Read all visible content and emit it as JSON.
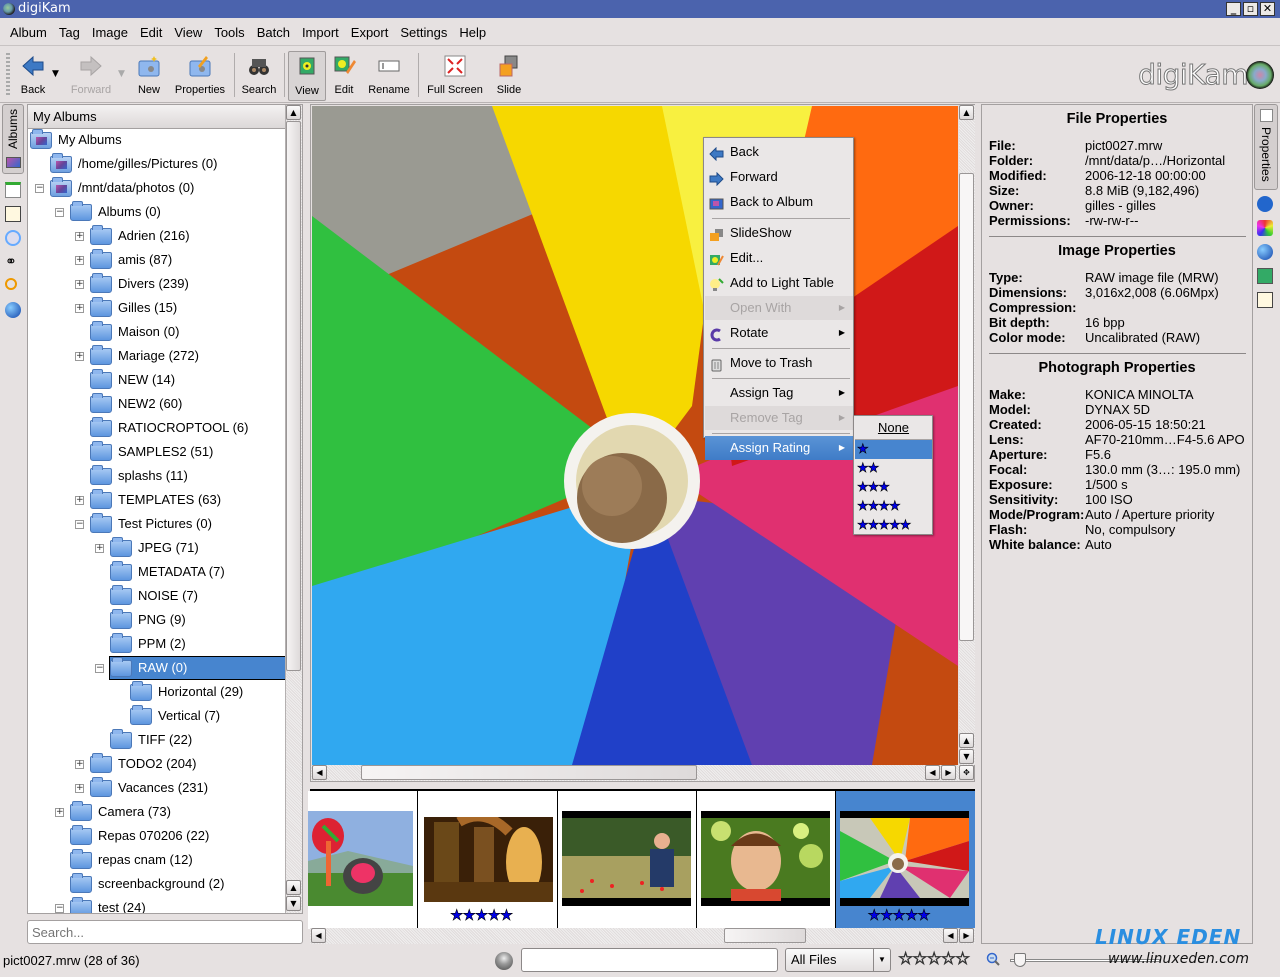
{
  "window": {
    "title": "digiKam",
    "logo_text": "digiKam"
  },
  "menubar": [
    {
      "label": "Album",
      "u": "A",
      "rest": "lbum"
    },
    {
      "label": "Tag",
      "u": "",
      "rest": "Tag"
    },
    {
      "label": "Image",
      "u": "I",
      "rest": "mage"
    },
    {
      "label": "Edit",
      "u": "E",
      "rest": "dit"
    },
    {
      "label": "View",
      "u": "V",
      "rest": "iew"
    },
    {
      "label": "Tools",
      "u": "T",
      "rest": "ools"
    },
    {
      "label": "Batch",
      "u": "B",
      "rest": "atch"
    },
    {
      "label": "Import",
      "u": "",
      "rest": "Import"
    },
    {
      "label": "Export",
      "u": "",
      "rest": "Export"
    },
    {
      "label": "Settings",
      "u": "S",
      "rest": "ettings"
    },
    {
      "label": "Help",
      "u": "H",
      "rest": "elp"
    }
  ],
  "toolbar": {
    "back": "Back",
    "forward": "Forward",
    "new": "New",
    "properties": "Properties",
    "search": "Search",
    "view": "View",
    "edit": "Edit",
    "rename": "Rename",
    "fullscreen": "Full Screen",
    "slide": "Slide"
  },
  "left_tabs": {
    "albums": "Albums"
  },
  "tree": {
    "header": "My Albums",
    "nodes": [
      {
        "label": "My Albums",
        "level": 0,
        "icon": "album"
      },
      {
        "label": "/home/gilles/Pictures (0)",
        "level": 1,
        "icon": "album"
      },
      {
        "label": "/mnt/data/photos (0)",
        "level": 1,
        "icon": "album",
        "exp": "-"
      },
      {
        "label": "Albums (0)",
        "level": 2,
        "exp": "-"
      },
      {
        "label": "Adrien (216)",
        "level": 3,
        "exp": "+"
      },
      {
        "label": "amis (87)",
        "level": 3,
        "exp": "+"
      },
      {
        "label": "Divers (239)",
        "level": 3,
        "exp": "+"
      },
      {
        "label": "Gilles (15)",
        "level": 3,
        "exp": "+"
      },
      {
        "label": "Maison (0)",
        "level": 3
      },
      {
        "label": "Mariage (272)",
        "level": 3,
        "exp": "+"
      },
      {
        "label": "NEW (14)",
        "level": 3
      },
      {
        "label": "NEW2 (60)",
        "level": 3
      },
      {
        "label": "RATIOCROPTOOL (6)",
        "level": 3
      },
      {
        "label": "SAMPLES2 (51)",
        "level": 3
      },
      {
        "label": "splashs (11)",
        "level": 3
      },
      {
        "label": "TEMPLATES (63)",
        "level": 3,
        "exp": "+"
      },
      {
        "label": "Test Pictures (0)",
        "level": 3,
        "exp": "-"
      },
      {
        "label": "JPEG (71)",
        "level": 4,
        "exp": "+"
      },
      {
        "label": "METADATA (7)",
        "level": 4
      },
      {
        "label": "NOISE (7)",
        "level": 4
      },
      {
        "label": "PNG (9)",
        "level": 4
      },
      {
        "label": "PPM (2)",
        "level": 4
      },
      {
        "label": "RAW (0)",
        "level": 4,
        "exp": "-",
        "selected": true
      },
      {
        "label": "Horizontal (29)",
        "level": 5
      },
      {
        "label": "Vertical (7)",
        "level": 5
      },
      {
        "label": "TIFF (22)",
        "level": 4
      },
      {
        "label": "TODO2 (204)",
        "level": 3,
        "exp": "+"
      },
      {
        "label": "Vacances (231)",
        "level": 3,
        "exp": "+"
      },
      {
        "label": "Camera (73)",
        "level": 2,
        "exp": "+"
      },
      {
        "label": "Repas 070206 (22)",
        "level": 2
      },
      {
        "label": "repas cnam (12)",
        "level": 2
      },
      {
        "label": "screenbackground (2)",
        "level": 2
      },
      {
        "label": "test (24)",
        "level": 2,
        "exp": "-"
      }
    ],
    "search_placeholder": "Search..."
  },
  "context_menu": {
    "items": [
      {
        "label": "Back",
        "icon": "back-arrow"
      },
      {
        "label": "Forward",
        "icon": "forward-arrow"
      },
      {
        "label": "Back to Album",
        "icon": "album"
      },
      {
        "sep": true
      },
      {
        "label": "SlideShow",
        "icon": "slideshow"
      },
      {
        "label": "Edit...",
        "icon": "edit"
      },
      {
        "label": "Add to Light Table",
        "icon": "lighttable"
      },
      {
        "label": "Open With",
        "disabled": true,
        "submenu": true
      },
      {
        "label": "Rotate",
        "icon": "rotate",
        "submenu": true
      },
      {
        "sep": true
      },
      {
        "label": "Move to Trash",
        "icon": "trash"
      },
      {
        "sep": true
      },
      {
        "label": "Assign Tag",
        "submenu": true
      },
      {
        "label": "Remove Tag",
        "disabled": true,
        "submenu": true
      },
      {
        "sep": true
      },
      {
        "label": "Assign Rating",
        "submenu": true,
        "highlighted": true
      }
    ]
  },
  "rating_submenu": {
    "none": "None",
    "options": [
      "★",
      "★★",
      "★★★",
      "★★★★",
      "★★★★★"
    ],
    "highlighted_index": 0
  },
  "properties": {
    "tab_label": "Properties",
    "file": {
      "title": "File Properties",
      "rows": [
        {
          "k": "File:",
          "v": "pict0027.mrw"
        },
        {
          "k": "Folder:",
          "v": "/mnt/data/p…/Horizontal"
        },
        {
          "k": "Modified:",
          "v": "2006-12-18 00:00:00"
        },
        {
          "k": "Size:",
          "v": "8.8 MiB (9,182,496)"
        },
        {
          "k": "Owner:",
          "v": "gilles - gilles"
        },
        {
          "k": "Permissions:",
          "v": "-rw-rw-r--"
        }
      ]
    },
    "image": {
      "title": "Image Properties",
      "rows": [
        {
          "k": "Type:",
          "v": "RAW image file (MRW)"
        },
        {
          "k": "Dimensions:",
          "v": "3,016x2,008 (6.06Mpx)"
        },
        {
          "k": "Compression:",
          "v": ""
        },
        {
          "k": "Bit depth:",
          "v": "16 bpp"
        },
        {
          "k": "Color mode:",
          "v": "Uncalibrated (RAW)"
        }
      ]
    },
    "photo": {
      "title": "Photograph Properties",
      "rows": [
        {
          "k": "Make:",
          "v": "KONICA MINOLTA"
        },
        {
          "k": "Model:",
          "v": "DYNAX 5D"
        },
        {
          "k": "Created:",
          "v": "2006-05-15 18:50:21"
        },
        {
          "k": "Lens:",
          "v": "AF70-210mm…F4-5.6 APO"
        },
        {
          "k": "Aperture:",
          "v": "F5.6"
        },
        {
          "k": "Focal:",
          "v": "130.0 mm (3…: 195.0 mm)"
        },
        {
          "k": "Exposure:",
          "v": "1/500 s"
        },
        {
          "k": "Sensitivity:",
          "v": "100 ISO"
        },
        {
          "k": "Mode/Program:",
          "v": "Auto / Aperture priority"
        },
        {
          "k": "Flash:",
          "v": "No, compulsory"
        },
        {
          "k": "White balance:",
          "v": "Auto"
        }
      ]
    }
  },
  "thumbnails": [
    {
      "name": "kites",
      "rating": 0
    },
    {
      "name": "cellar-arches",
      "rating": 5
    },
    {
      "name": "boy-in-field",
      "rating": 0
    },
    {
      "name": "boy-portrait",
      "rating": 0
    },
    {
      "name": "pinwheel",
      "rating": 5,
      "selected": true
    }
  ],
  "statusbar": {
    "text": "pict0027.mrw (28 of 36)",
    "filter_value": "",
    "file_filter": "All Files",
    "rating_filter": "☆☆☆☆☆",
    "watermark": "LINUX EDEN",
    "watermark_url": "www.linuxeden.com"
  },
  "colors": {
    "selection": "#4785cf",
    "titlebar": "#4b63ad",
    "star": "#0000e8"
  }
}
